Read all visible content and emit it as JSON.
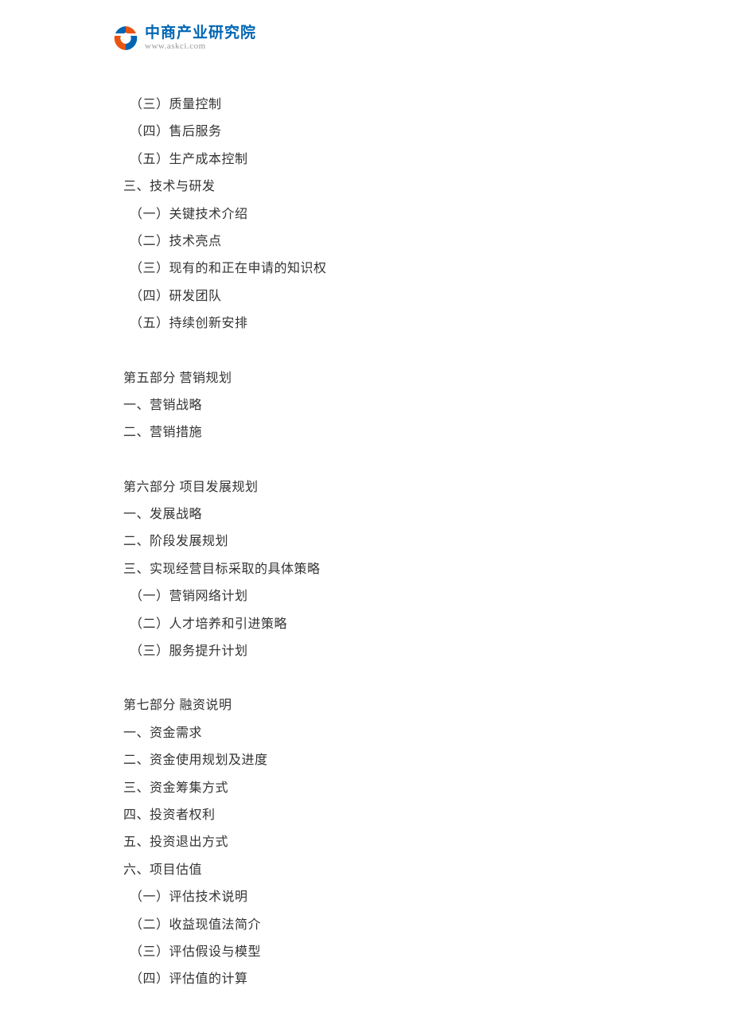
{
  "header": {
    "title": "中商产业研究院",
    "url": "www.askci.com"
  },
  "content": {
    "lines": [
      "（三）质量控制",
      "（四）售后服务",
      "（五）生产成本控制",
      "三、技术与研发",
      "（一）关键技术介绍",
      "（二）技术亮点",
      "（三）现有的和正在申请的知识权",
      "（四）研发团队",
      "（五）持续创新安排"
    ],
    "section5_title": "第五部分  营销规划",
    "section5_lines": [
      "一、营销战略",
      "二、营销措施"
    ],
    "section6_title": "第六部分  项目发展规划",
    "section6_lines": [
      "一、发展战略",
      "二、阶段发展规划",
      "三、实现经营目标采取的具体策略",
      "（一）营销网络计划",
      "（二）人才培养和引进策略",
      "（三）服务提升计划"
    ],
    "section7_title": "第七部分  融资说明",
    "section7_lines": [
      "一、资金需求",
      "二、资金使用规划及进度",
      "三、资金筹集方式",
      "四、投资者权利",
      "五、投资退出方式",
      "六、项目估值",
      "（一）评估技术说明",
      "（二）收益现值法简介",
      "（三）评估假设与模型",
      "（四）评估值的计算"
    ]
  }
}
